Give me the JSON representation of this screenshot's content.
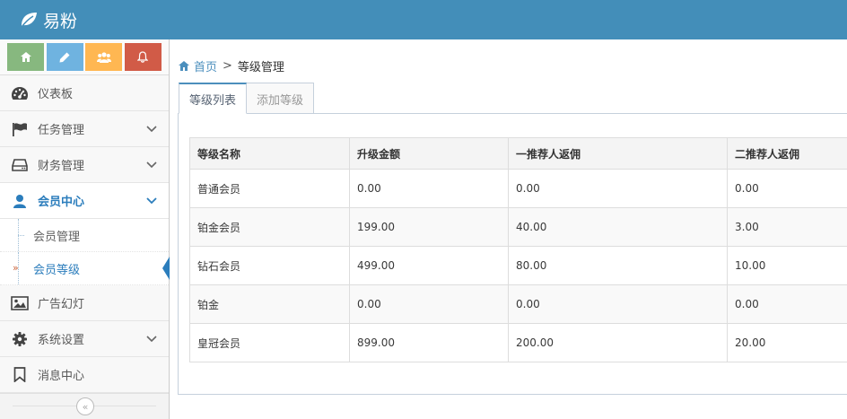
{
  "app": {
    "name": "易粉"
  },
  "sidebar": {
    "shortcuts": [
      {
        "icon": "home-icon",
        "color": "#87b87f"
      },
      {
        "icon": "pencil-icon",
        "color": "#6fb3e0"
      },
      {
        "icon": "users-icon",
        "color": "#ffb752"
      },
      {
        "icon": "bell-icon",
        "color": "#d15b47"
      }
    ],
    "items": [
      {
        "label": "仪表板",
        "icon": "dashboard-icon"
      },
      {
        "label": "任务管理",
        "icon": "flag-icon"
      },
      {
        "label": "财务管理",
        "icon": "hdd-icon"
      },
      {
        "label": "会员中心",
        "icon": "user-icon"
      },
      {
        "label": "广告幻灯",
        "icon": "picture-icon"
      },
      {
        "label": "系统设置",
        "icon": "cog-icon"
      },
      {
        "label": "消息中心",
        "icon": "bookmark-icon"
      }
    ],
    "member_sub": [
      {
        "label": "会员管理"
      },
      {
        "label": "会员等级"
      }
    ]
  },
  "breadcrumb": {
    "home": "首页",
    "separator": ">",
    "current": "等级管理"
  },
  "tabs": [
    {
      "label": "等级列表"
    },
    {
      "label": "添加等级"
    }
  ],
  "table": {
    "headers": [
      "等级名称",
      "升级金额",
      "一推荐人返佣",
      "二推荐人返佣"
    ],
    "rows": [
      [
        "普通会员",
        "0.00",
        "0.00",
        "0.00"
      ],
      [
        "铂金会员",
        "199.00",
        "40.00",
        "3.00"
      ],
      [
        "钻石会员",
        "499.00",
        "80.00",
        "10.00"
      ],
      [
        "铂金",
        "0.00",
        "0.00",
        "0.00"
      ],
      [
        "皇冠会员",
        "899.00",
        "200.00",
        "20.00"
      ]
    ]
  },
  "colors": {
    "header": "#438eb9",
    "accent": "#2b7dbc",
    "pointer": "#c86139"
  }
}
